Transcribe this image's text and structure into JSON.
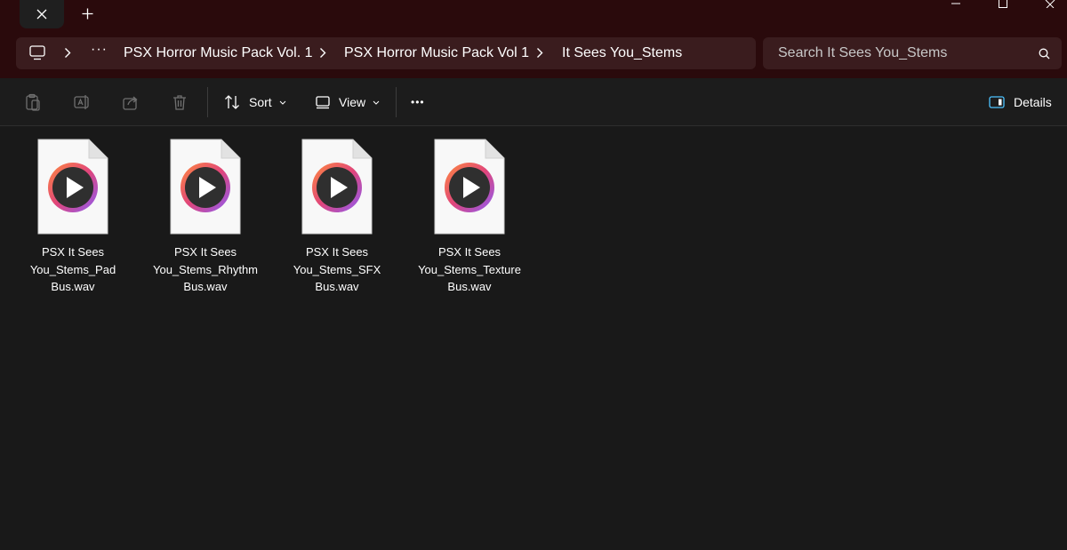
{
  "window": {
    "tab_close_icon": "close-icon",
    "new_tab_icon": "plus-icon",
    "controls": [
      "minimize-icon",
      "maximize-icon",
      "close-icon"
    ]
  },
  "address": {
    "breadcrumbs": [
      "PSX Horror Music Pack Vol. 1",
      "PSX Horror Music Pack Vol 1",
      "It Sees You_Stems"
    ],
    "overflow_label": "···"
  },
  "search": {
    "placeholder": "Search It Sees You_Stems"
  },
  "toolbar": {
    "sort_label": "Sort",
    "view_label": "View",
    "more_label": "•••",
    "details_label": "Details"
  },
  "files": [
    {
      "name_lines": [
        "PSX It Sees",
        "You_Stems_Pad",
        "Bus.wav"
      ]
    },
    {
      "name_lines": [
        "PSX It Sees",
        "You_Stems_Rhythm",
        "Bus.wav"
      ]
    },
    {
      "name_lines": [
        "PSX It Sees",
        "You_Stems_SFX",
        "Bus.wav"
      ]
    },
    {
      "name_lines": [
        "PSX It Sees",
        "You_Stems_Texture",
        "Bus.wav"
      ]
    }
  ],
  "colors": {
    "titlebar_bg": "#2a0a0c",
    "field_bg": "#3a1c1e",
    "content_bg": "#191919",
    "accent_blue": "#4cc2ff"
  }
}
